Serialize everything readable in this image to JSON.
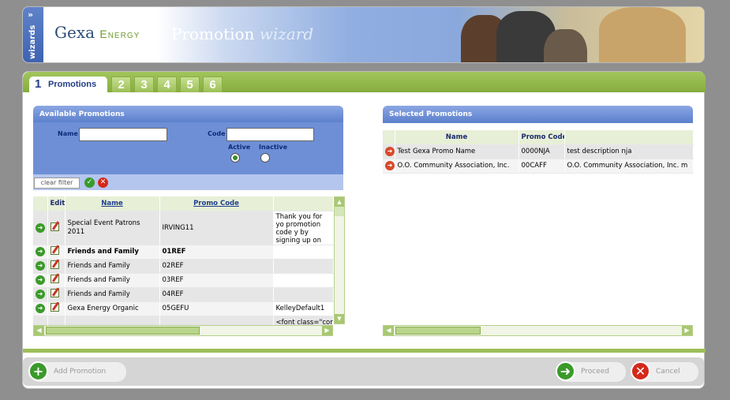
{
  "header": {
    "wizards_tab": "wizards",
    "logo_gexa": "Gexa",
    "logo_energy": "Energy",
    "title_bold": "Promotion",
    "title_light": "wizard"
  },
  "tabs": {
    "active_num": "1",
    "active_label": "Promotions",
    "steps": [
      "2",
      "3",
      "4",
      "5",
      "6"
    ]
  },
  "available": {
    "title": "Available Promotions",
    "name_label": "Name",
    "code_label": "Code",
    "name_value": "",
    "code_value": "",
    "active_label": "Active",
    "inactive_label": "Inactive",
    "status_selected": "Active",
    "clear_filter": "clear filter",
    "columns": [
      "Edit",
      "Name",
      "Promo Code"
    ],
    "rows": [
      {
        "name": "Special Event Patrons 2011",
        "code": "IRVING11",
        "desc": "Thank you for yo promotion code y by signing up on",
        "bold": false
      },
      {
        "name": "Friends and Family",
        "code": "01REF",
        "desc": "",
        "bold": true
      },
      {
        "name": "Friends and Family",
        "code": "02REF",
        "desc": "",
        "bold": false
      },
      {
        "name": "Friends and Family",
        "code": "03REF",
        "desc": "",
        "bold": false
      },
      {
        "name": "Friends and Family",
        "code": "04REF",
        "desc": "",
        "bold": false
      },
      {
        "name": "Gexa Energy Organic",
        "code": "05GEFU",
        "desc": "KelleyDefault1",
        "bold": false
      },
      {
        "name": "",
        "code": "",
        "desc": "<font class=\"cor",
        "bold": false
      }
    ]
  },
  "selected": {
    "title": "Selected Promotions",
    "columns": [
      "Name",
      "Promo Code"
    ],
    "rows": [
      {
        "name": "Test Gexa Promo Name",
        "code": "0000NJA",
        "desc": "test description nja"
      },
      {
        "name": "O.O. Community Association, Inc.",
        "code": "00CAFF",
        "desc": "O.O. Community Association, Inc. m"
      }
    ]
  },
  "footer": {
    "add_label": "Add Promotion",
    "proceed_label": "Proceed",
    "cancel_label": "Cancel"
  },
  "colors": {
    "accent_green": "#9dbf58",
    "panel_blue": "#5a7fcc",
    "brand_navy": "#243e85"
  },
  "icons": [
    "chevrons-icon",
    "go-arrow-icon",
    "edit-icon",
    "remove-icon",
    "check-icon",
    "cancel-x-icon",
    "plus-icon"
  ]
}
